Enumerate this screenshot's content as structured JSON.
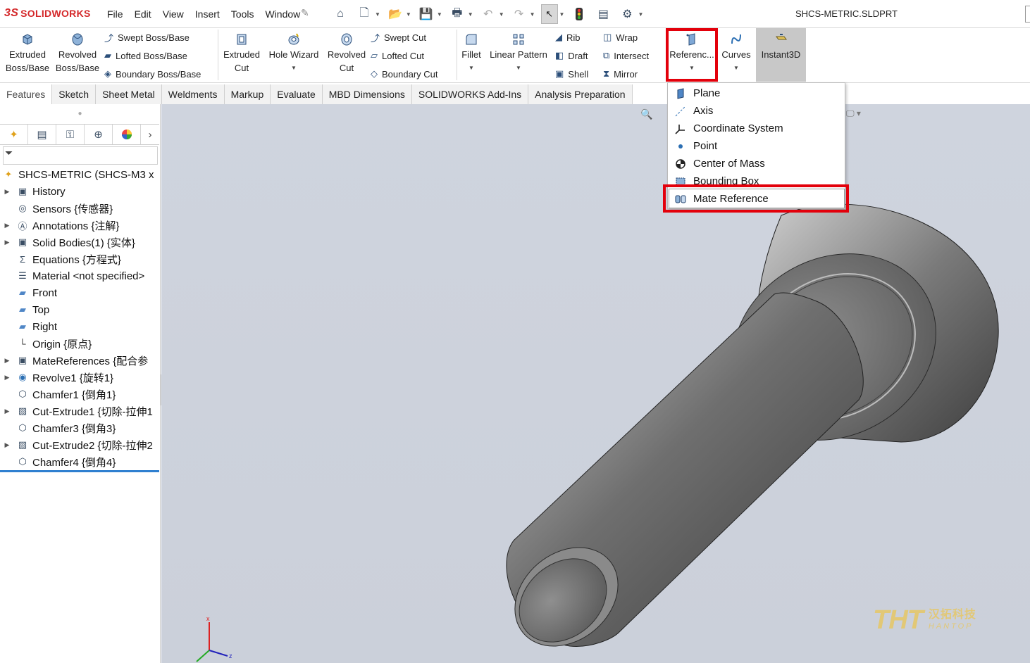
{
  "app": {
    "logo_mark": "3S",
    "logo_text": "SOLIDWORKS",
    "document_title": "SHCS-METRIC.SLDPRT"
  },
  "menu": [
    "File",
    "Edit",
    "View",
    "Insert",
    "Tools",
    "Window"
  ],
  "toolbar": {
    "extruded_boss": "Extruded\nBoss/Base",
    "revolved_boss": "Revolved\nBoss/Base",
    "swept_boss": "Swept Boss/Base",
    "lofted_boss": "Lofted Boss/Base",
    "boundary_boss": "Boundary Boss/Base",
    "extruded_cut": "Extruded\nCut",
    "hole_wizard": "Hole Wizard",
    "revolved_cut": "Revolved\nCut",
    "swept_cut": "Swept Cut",
    "lofted_cut": "Lofted Cut",
    "boundary_cut": "Boundary Cut",
    "fillet": "Fillet",
    "linear_pattern": "Linear Pattern",
    "rib": "Rib",
    "draft": "Draft",
    "shell": "Shell",
    "wrap": "Wrap",
    "intersect": "Intersect",
    "mirror": "Mirror",
    "reference": "Referenc...",
    "curves": "Curves",
    "instant3d": "Instant3D"
  },
  "tabs": [
    "Features",
    "Sketch",
    "Sheet Metal",
    "Weldments",
    "Markup",
    "Evaluate",
    "MBD Dimensions",
    "SOLIDWORKS Add-Ins",
    "Analysis Preparation"
  ],
  "active_tab": "Features",
  "tree": {
    "root": "SHCS-METRIC  (SHCS-M3 x",
    "items": [
      {
        "label": "History",
        "expandable": true,
        "icon": "history-folder-icon"
      },
      {
        "label": "Sensors {传感器}",
        "expandable": false,
        "icon": "sensors-icon"
      },
      {
        "label": "Annotations {注解}",
        "expandable": true,
        "icon": "annotations-icon"
      },
      {
        "label": "Solid Bodies(1) {实体}",
        "expandable": true,
        "icon": "solid-bodies-icon"
      },
      {
        "label": "Equations {方程式}",
        "expandable": false,
        "icon": "equations-icon"
      },
      {
        "label": "Material <not specified>",
        "expandable": false,
        "icon": "material-icon"
      },
      {
        "label": "Front",
        "expandable": false,
        "icon": "plane-icon"
      },
      {
        "label": "Top",
        "expandable": false,
        "icon": "plane-icon"
      },
      {
        "label": "Right",
        "expandable": false,
        "icon": "plane-icon"
      },
      {
        "label": "Origin {原点}",
        "expandable": false,
        "icon": "origin-icon"
      },
      {
        "label": "MateReferences {配合参",
        "expandable": true,
        "icon": "mate-references-icon"
      },
      {
        "label": "Revolve1 {旋转1}",
        "expandable": true,
        "icon": "revolve-icon"
      },
      {
        "label": "Chamfer1 {倒角1}",
        "expandable": false,
        "icon": "chamfer-icon"
      },
      {
        "label": "Cut-Extrude1 {切除-拉伸1",
        "expandable": true,
        "icon": "cut-extrude-icon"
      },
      {
        "label": "Chamfer3 {倒角3}",
        "expandable": false,
        "icon": "chamfer-icon"
      },
      {
        "label": "Cut-Extrude2 {切除-拉伸2",
        "expandable": true,
        "icon": "cut-extrude-icon"
      },
      {
        "label": "Chamfer4 {倒角4}",
        "expandable": false,
        "icon": "chamfer-icon"
      }
    ]
  },
  "reference_menu": [
    {
      "label": "Plane",
      "icon": "plane-icon"
    },
    {
      "label": "Axis",
      "icon": "axis-icon"
    },
    {
      "label": "Coordinate System",
      "icon": "coordinate-system-icon"
    },
    {
      "label": "Point",
      "icon": "point-icon"
    },
    {
      "label": "Center of Mass",
      "icon": "center-of-mass-icon"
    },
    {
      "label": "Bounding Box",
      "icon": "bounding-box-icon"
    },
    {
      "label": "Mate Reference",
      "icon": "mate-reference-icon"
    }
  ],
  "triad": {
    "x": "x",
    "z": "z"
  },
  "watermark": {
    "big": "THT",
    "cn": "汉拓科技",
    "en": "HANTOP"
  },
  "colors": {
    "highlight": "#e3000b",
    "accent_blue": "#2f7fd0",
    "brand_red": "#d4282a"
  }
}
